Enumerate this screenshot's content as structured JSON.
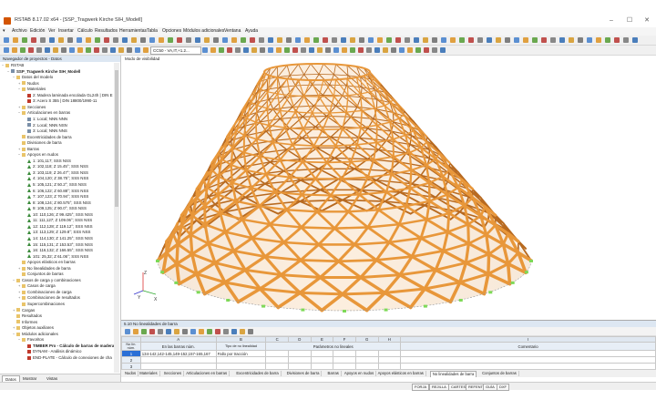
{
  "app": {
    "title": "RSTAB 8.17.02 x64 - [SSP_Tragwerk Kirche SIH_Modell]",
    "window_buttons": {
      "minimize": "–",
      "maximize": "☐",
      "close": "✕"
    }
  },
  "menu": [
    "Archivo",
    "Edición",
    "Ver",
    "Insertar",
    "Cálculo",
    "Resultados",
    "Herramientas",
    "Tabla",
    "Opciones",
    "Módulos adicionales",
    "Ventana",
    "Ayuda"
  ],
  "toolbar": {
    "loadcase_combo": "CC50 - VA,IT,+1.2..."
  },
  "navigator": {
    "header": "Navegador de proyectos - Datos",
    "tree": [
      {
        "text": "RSTAB",
        "level": 0,
        "icon": "folder",
        "exp": "−"
      },
      {
        "text": "SSP_Tragwerk Kirche SIH_Modell",
        "level": 1,
        "icon": "item",
        "exp": "−",
        "bold": true
      },
      {
        "text": "Datos del modelo",
        "level": 2,
        "icon": "folder",
        "exp": "−"
      },
      {
        "text": "Nudos",
        "level": 3,
        "icon": "folder",
        "exp": "+"
      },
      {
        "text": "Materiales",
        "level": 3,
        "icon": "folder",
        "exp": "−"
      },
      {
        "text": "2: Madera laminada encolada GL24h | DIN E",
        "level": 4,
        "icon": "doc",
        "exp": ""
      },
      {
        "text": "3: Acero S 355 | DIN 18800/1990-11",
        "level": 4,
        "icon": "doc",
        "exp": ""
      },
      {
        "text": "Secciones",
        "level": 3,
        "icon": "folder",
        "exp": "+"
      },
      {
        "text": "Articulaciones en barras",
        "level": 3,
        "icon": "folder",
        "exp": "−"
      },
      {
        "text": "1: Local; NNN NNN",
        "level": 4,
        "icon": "item",
        "exp": ""
      },
      {
        "text": "2: Local; NNN NSN",
        "level": 4,
        "icon": "item",
        "exp": ""
      },
      {
        "text": "3: Local; NNN NNS",
        "level": 4,
        "icon": "item",
        "exp": ""
      },
      {
        "text": "Excentricidades de barra",
        "level": 3,
        "icon": "folder",
        "exp": ""
      },
      {
        "text": "Divisiones de barra",
        "level": 3,
        "icon": "folder",
        "exp": ""
      },
      {
        "text": "Barras",
        "level": 3,
        "icon": "folder",
        "exp": "+"
      },
      {
        "text": "Apoyos en nudos",
        "level": 3,
        "icon": "folder",
        "exp": "−"
      },
      {
        "text": "1: 101,117; SSS NSS",
        "level": 4,
        "icon": "support",
        "exp": ""
      },
      {
        "text": "2: 102,118; Z 15.45°; SSS NSS",
        "level": 4,
        "icon": "support",
        "exp": ""
      },
      {
        "text": "3: 103,119; Z 26.47°; SSS NSS",
        "level": 4,
        "icon": "support",
        "exp": ""
      },
      {
        "text": "4: 104,120; Z 38.75°; SSS NSS",
        "level": 4,
        "icon": "support",
        "exp": ""
      },
      {
        "text": "5: 105,121; Z 50.2°; SSS NSS",
        "level": 4,
        "icon": "support",
        "exp": ""
      },
      {
        "text": "6: 106,122; Z 60.88°; SSS NSS",
        "level": 4,
        "icon": "support",
        "exp": ""
      },
      {
        "text": "7: 107,123; Z 70.94°; SSS NSS",
        "level": 4,
        "icon": "support",
        "exp": ""
      },
      {
        "text": "8: 108,124; Z 80.575°; SSS NSS",
        "level": 4,
        "icon": "support",
        "exp": ""
      },
      {
        "text": "9: 109,125; Z 90.0°; SSS NSS",
        "level": 4,
        "icon": "support",
        "exp": ""
      },
      {
        "text": "10: 110,126; Z 99.425°; SSS NSS",
        "level": 4,
        "icon": "support",
        "exp": ""
      },
      {
        "text": "11: 111,127; Z 109.06°; SSS NSS",
        "level": 4,
        "icon": "support",
        "exp": ""
      },
      {
        "text": "12: 112,128; Z 119.12°; SSS NSS",
        "level": 4,
        "icon": "support",
        "exp": ""
      },
      {
        "text": "13: 113,129; Z 129.8°; SSS NSS",
        "level": 4,
        "icon": "support",
        "exp": ""
      },
      {
        "text": "14: 114,130; Z 141.25°; SSS NSS",
        "level": 4,
        "icon": "support",
        "exp": ""
      },
      {
        "text": "15: 115,131; Z 153.53°; SSS NSS",
        "level": 4,
        "icon": "support",
        "exp": ""
      },
      {
        "text": "16: 116,132; Z 166.55°; SSS NSS",
        "level": 4,
        "icon": "support",
        "exp": ""
      },
      {
        "text": "101: 25,32; Z 61.06°; SSS NSS",
        "level": 4,
        "icon": "support",
        "exp": ""
      },
      {
        "text": "Apoyos elásticos en barras",
        "level": 3,
        "icon": "folder",
        "exp": ""
      },
      {
        "text": "No linealidades de barra",
        "level": 3,
        "icon": "folder",
        "exp": "+"
      },
      {
        "text": "Conjuntos de barras",
        "level": 3,
        "icon": "folder",
        "exp": ""
      },
      {
        "text": "Casos de carga y combinaciones",
        "level": 2,
        "icon": "folder",
        "exp": "−"
      },
      {
        "text": "Casos de carga",
        "level": 3,
        "icon": "folder",
        "exp": "+"
      },
      {
        "text": "Combinaciones de carga",
        "level": 3,
        "icon": "folder",
        "exp": "+"
      },
      {
        "text": "Combinaciones de resultados",
        "level": 3,
        "icon": "folder",
        "exp": "+"
      },
      {
        "text": "Supercombinaciones",
        "level": 3,
        "icon": "folder",
        "exp": ""
      },
      {
        "text": "Cargas",
        "level": 2,
        "icon": "folder",
        "exp": "+"
      },
      {
        "text": "Resultados",
        "level": 2,
        "icon": "folder",
        "exp": ""
      },
      {
        "text": "Informes",
        "level": 2,
        "icon": "folder",
        "exp": ""
      },
      {
        "text": "Objetos auxiliares",
        "level": 2,
        "icon": "folder",
        "exp": "+"
      },
      {
        "text": "Módulos adicionales",
        "level": 2,
        "icon": "folder",
        "exp": "−"
      },
      {
        "text": "Favoritos",
        "level": 3,
        "icon": "folder",
        "exp": "−"
      },
      {
        "text": "TIMBER Pro - Cálculo de barras de madera",
        "level": 4,
        "icon": "doc",
        "exp": "",
        "bold": true
      },
      {
        "text": "DYNAM - Análisis dinámico",
        "level": 4,
        "icon": "doc",
        "exp": ""
      },
      {
        "text": "END-PLATE - Cálculo de conexiones de cha",
        "level": 4,
        "icon": "doc",
        "exp": ""
      }
    ],
    "tabs": [
      "Datos",
      "Mostrar",
      "Vistas"
    ]
  },
  "viewport": {
    "label": "Modo de visibilidad",
    "axis_x": "X",
    "axis_y": "Y",
    "axis_z": "Z"
  },
  "bottom_panel": {
    "title": "5.10 No linealidades de barra",
    "col_letters": [
      "A",
      "B",
      "C",
      "D",
      "E",
      "F",
      "G",
      "H",
      "I"
    ],
    "headers": {
      "no": "No lín. núm.",
      "in_members": "En las barras núm.",
      "type": "Tipo de no linealidad",
      "params": "Parámetros no lineales",
      "comment": "Comentario"
    },
    "rows": [
      {
        "no": "1",
        "members": "134-142,142-145,149-152,157-165,167",
        "type": "Fallo por tracción"
      },
      {
        "no": "2",
        "members": "",
        "type": ""
      },
      {
        "no": "3",
        "members": "",
        "type": ""
      }
    ],
    "tabs": [
      "Nudos",
      "Materiales",
      "Secciones",
      "Articulaciones en barras",
      "Excentricidades de barra",
      "Divisiones de barra",
      "Barras",
      "Apoyos en nudos",
      "Apoyos elásticos en barras",
      "No linealidades de barra",
      "Conjuntos de barras"
    ],
    "active_tab": "No linealidades de barra"
  },
  "status": [
    "FORJA",
    "REJILLA",
    "CARTES",
    "REFENT",
    "GUÍA",
    "DXF"
  ],
  "colors": {
    "timber": "#e8973a",
    "timber_dark": "#b86a20",
    "support": "#7ed957",
    "accent": "#2a6fd6"
  }
}
